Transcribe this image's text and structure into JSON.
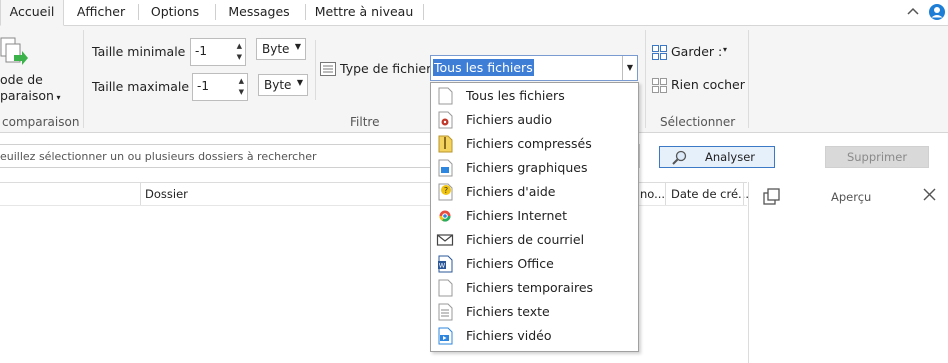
{
  "tabs": [
    {
      "label": "Accueil",
      "active": true
    },
    {
      "label": "Afficher",
      "active": false
    },
    {
      "label": "Options",
      "active": false
    },
    {
      "label": "Messages",
      "active": false
    },
    {
      "label": "Mettre à niveau",
      "active": false
    }
  ],
  "ribbon": {
    "comparison": {
      "mode_line1": "ode de",
      "mode_line2": "paraison",
      "group_label": "comparaison"
    },
    "filter": {
      "min_label": "Taille minimale :",
      "min_value": "-1",
      "min_unit": "Byte",
      "max_label": "Taille maximale :",
      "max_value": "-1",
      "max_unit": "Byte",
      "filetype_label": "Type de fichier",
      "filetype_value": "Tous les fichiers",
      "group_label": "Filtre"
    },
    "select": {
      "keep_label": "Garder :",
      "uncheck_label": "Rien cocher",
      "group_label": "Sélectionner"
    }
  },
  "path_placeholder": "euillez sélectionner un ou plusieurs dossiers à rechercher",
  "analyze_label": "Analyser",
  "delete_label": "Supprimer",
  "columns": {
    "folder": "Dossier",
    "nom": "no...",
    "date": "Date de cré..."
  },
  "preview": {
    "title": "Aperçu"
  },
  "filetype_options": [
    {
      "label": "Tous les fichiers",
      "icon": "blank-file-icon"
    },
    {
      "label": "Fichiers audio",
      "icon": "audio-file-icon"
    },
    {
      "label": "Fichiers compressés",
      "icon": "zip-file-icon"
    },
    {
      "label": "Fichiers graphiques",
      "icon": "image-file-icon"
    },
    {
      "label": "Fichiers d'aide",
      "icon": "help-file-icon"
    },
    {
      "label": "Fichiers Internet",
      "icon": "chrome-icon"
    },
    {
      "label": "Fichiers de courriel",
      "icon": "envelope-icon"
    },
    {
      "label": "Fichiers Office",
      "icon": "word-file-icon"
    },
    {
      "label": "Fichiers temporaires",
      "icon": "blank-file-icon"
    },
    {
      "label": "Fichiers texte",
      "icon": "text-file-icon"
    },
    {
      "label": "Fichiers vidéo",
      "icon": "video-file-icon"
    }
  ],
  "colors": {
    "accent": "#3f7ed6",
    "ribbon_bg": "#f5f5f5",
    "analyze_border": "#3b78c6",
    "help_blue": "#1e7ed6"
  }
}
